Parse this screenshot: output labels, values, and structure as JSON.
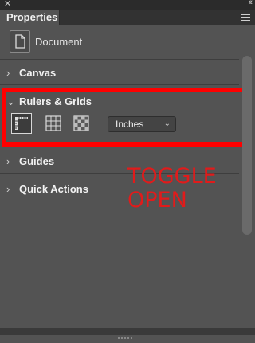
{
  "topbar": {
    "close_icon": "close-icon",
    "collapse_icon": "collapse-panel-icon"
  },
  "tab": {
    "label": "Properties"
  },
  "document": {
    "label": "Document"
  },
  "sections": [
    {
      "label": "Canvas",
      "state": "collapsed"
    },
    {
      "label": "Rulers & Grids",
      "state": "expanded"
    },
    {
      "label": "Guides",
      "state": "collapsed"
    },
    {
      "label": "Quick Actions",
      "state": "collapsed"
    }
  ],
  "rulers": {
    "units_select": {
      "value": "Inches",
      "options": [
        "Inches"
      ]
    }
  },
  "annotation": {
    "line1": "TOGGLE",
    "line2": "OPEN",
    "color": "#e11b1b"
  },
  "colors": {
    "panel_bg": "#535353",
    "highlight_border": "#ff0000"
  }
}
